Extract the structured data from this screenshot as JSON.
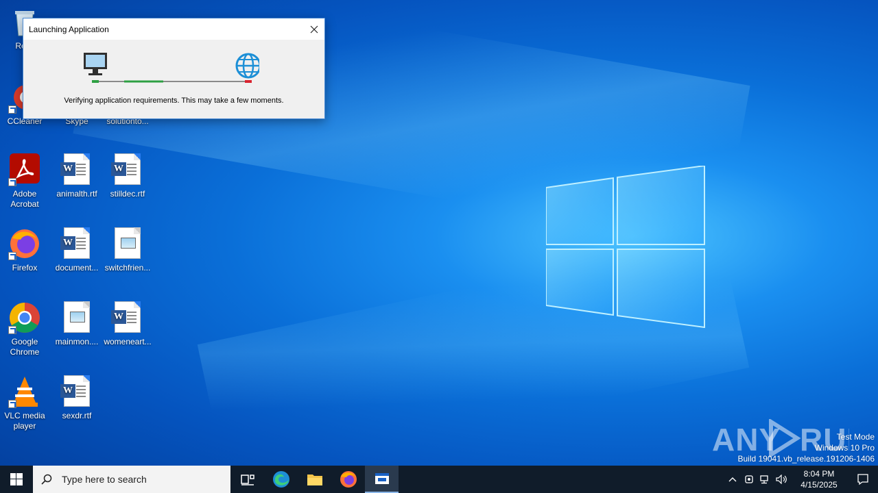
{
  "desktop": {
    "icons": [
      {
        "label": "Recy",
        "kind": "recycle-bin"
      },
      {
        "label": "CCleaner",
        "kind": "app"
      },
      {
        "label": "Skype",
        "kind": "app"
      },
      {
        "label": "solutionto...",
        "kind": "document"
      },
      {
        "label": "Adobe Acrobat",
        "kind": "app"
      },
      {
        "label": "animalth.rtf",
        "kind": "word"
      },
      {
        "label": "stilldec.rtf",
        "kind": "word"
      },
      {
        "label": "Firefox",
        "kind": "app"
      },
      {
        "label": "document...",
        "kind": "word"
      },
      {
        "label": "switchfrien...",
        "kind": "image"
      },
      {
        "label": "Google Chrome",
        "kind": "app"
      },
      {
        "label": "mainmon....",
        "kind": "image"
      },
      {
        "label": "womeneart...",
        "kind": "word"
      },
      {
        "label": "VLC media player",
        "kind": "app"
      },
      {
        "label": "sexdr.rtf",
        "kind": "word"
      }
    ]
  },
  "dialog": {
    "title": "Launching Application",
    "message": "Verifying application requirements. This may take a few moments.",
    "close_icon": "close-icon",
    "progress_colors": {
      "start": "#2ea043",
      "end": "#d9232f",
      "track": "#8a8a8a"
    }
  },
  "taskbar": {
    "search_placeholder": "Type here to search",
    "apps": [
      "task-view",
      "edge",
      "file-explorer",
      "firefox",
      "launcher"
    ],
    "clock_time": "8:04 PM",
    "clock_date": "4/15/2025"
  },
  "watermark": {
    "line1": "Test Mode",
    "line2": "Windows 10 Pro",
    "line3": "Build 19041.vb_release.191206-1406",
    "brand": "ANY RUN"
  },
  "colors": {
    "desktop_accent": "#0a6fd8",
    "taskbar": "#101c2a",
    "dialog_border": "#4a8ad4"
  }
}
